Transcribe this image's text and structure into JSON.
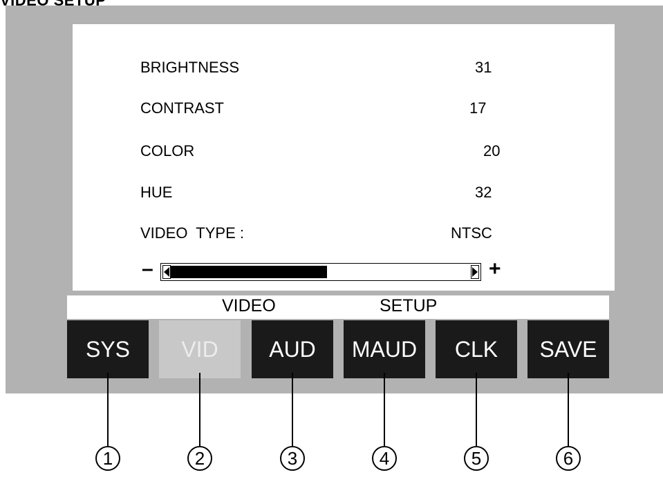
{
  "title": "VIDEO SETUP",
  "settings": [
    {
      "label": "BRIGHTNESS",
      "value": "31"
    },
    {
      "label": "CONTRAST",
      "value": "17"
    },
    {
      "label": "COLOR",
      "value": "20"
    },
    {
      "label": "HUE",
      "value": "32"
    },
    {
      "label": "VIDEO  TYPE :",
      "value": "NTSC"
    }
  ],
  "slider": {
    "minus": "–",
    "plus": "+",
    "level": 0.52
  },
  "menu_bar": {
    "word1": "VIDEO",
    "word2": "SETUP"
  },
  "buttons": [
    {
      "label": "SYS",
      "state": "normal"
    },
    {
      "label": "VID",
      "state": "selected-disabled"
    },
    {
      "label": "AUD",
      "state": "normal"
    },
    {
      "label": "MAUD",
      "state": "normal"
    },
    {
      "label": "CLK",
      "state": "normal"
    },
    {
      "label": "SAVE",
      "state": "normal"
    }
  ],
  "callouts": [
    "1",
    "2",
    "3",
    "4",
    "5",
    "6"
  ],
  "colors": {
    "frame": "#b2b2b2",
    "button": "#1a1a1a",
    "button_disabled": "#c8c8c8",
    "button_text": "#ffffff"
  }
}
